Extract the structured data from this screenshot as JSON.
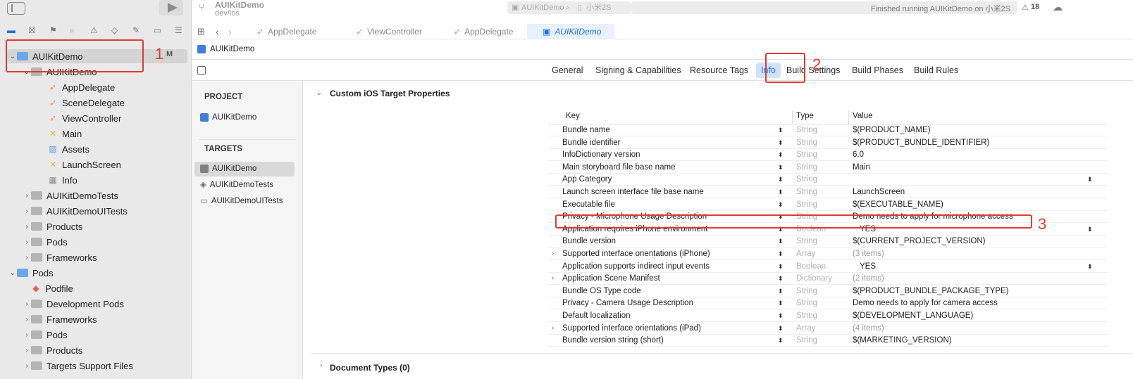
{
  "toolbar": {
    "project_name": "AUIKitDemo",
    "branch": "dev/ios",
    "scheme_target": "AUIKitDemo",
    "scheme_device": "小米2S",
    "status": "Finished running AUIKitDemo on 小米2S",
    "warnings_count": "18"
  },
  "navigator": {
    "project_label": "AUIKitDemo",
    "project_badge": "M",
    "items": [
      {
        "label": "AUIKitDemo",
        "kind": "folder"
      },
      {
        "label": "AppDelegate",
        "kind": "swift"
      },
      {
        "label": "SceneDelegate",
        "kind": "swift"
      },
      {
        "label": "ViewController",
        "kind": "swift"
      },
      {
        "label": "Main",
        "kind": "storyboard"
      },
      {
        "label": "Assets",
        "kind": "assets"
      },
      {
        "label": "LaunchScreen",
        "kind": "storyboard"
      },
      {
        "label": "Info",
        "kind": "plist"
      },
      {
        "label": "AUIKitDemoTests",
        "kind": "folder"
      },
      {
        "label": "AUIKitDemoUITests",
        "kind": "folder"
      },
      {
        "label": "Products",
        "kind": "folder"
      },
      {
        "label": "Pods",
        "kind": "folder"
      },
      {
        "label": "Frameworks",
        "kind": "folder"
      },
      {
        "label": "Pods",
        "kind": "project"
      },
      {
        "label": "Podfile",
        "kind": "podfile"
      },
      {
        "label": "Development Pods",
        "kind": "folder"
      },
      {
        "label": "Frameworks",
        "kind": "folder"
      },
      {
        "label": "Pods",
        "kind": "folder"
      },
      {
        "label": "Products",
        "kind": "folder"
      },
      {
        "label": "Targets Support Files",
        "kind": "folder"
      }
    ]
  },
  "editor_tabs": [
    "AppDelegate",
    "ViewController",
    "AppDelegate",
    "AUIKitDemo"
  ],
  "jump_bar": "AUIKitDemo",
  "info_tabs": [
    "General",
    "Signing & Capabilities",
    "Resource Tags",
    "Info",
    "Build Settings",
    "Build Phases",
    "Build Rules"
  ],
  "targets_panel": {
    "project_header": "PROJECT",
    "project_item": "AUIKitDemo",
    "targets_header": "TARGETS",
    "targets": [
      "AUIKitDemo",
      "AUIKitDemoTests",
      "AUIKitDemoUITests"
    ]
  },
  "properties": {
    "section_title": "Custom iOS Target Properties",
    "col_key": "Key",
    "col_type": "Type",
    "col_value": "Value",
    "rows": [
      {
        "key": "Bundle name",
        "type": "String",
        "value": "$(PRODUCT_NAME)"
      },
      {
        "key": "Bundle identifier",
        "type": "String",
        "value": "$(PRODUCT_BUNDLE_IDENTIFIER)"
      },
      {
        "key": "InfoDictionary version",
        "type": "String",
        "value": "6.0"
      },
      {
        "key": "Main storyboard file base name",
        "type": "String",
        "value": "Main"
      },
      {
        "key": "App Category",
        "type": "String",
        "value": ""
      },
      {
        "key": "Launch screen interface file base name",
        "type": "String",
        "value": "LaunchScreen"
      },
      {
        "key": "Executable file",
        "type": "String",
        "value": "$(EXECUTABLE_NAME)"
      },
      {
        "key": "Privacy - Microphone Usage Description",
        "type": "String",
        "value": "Demo needs to apply for microphone access"
      },
      {
        "key": "Application requires iPhone environment",
        "type": "Boolean",
        "value": "YES"
      },
      {
        "key": "Bundle version",
        "type": "String",
        "value": "$(CURRENT_PROJECT_VERSION)"
      },
      {
        "key": "Supported interface orientations (iPhone)",
        "type": "Array",
        "value": "(3 items)"
      },
      {
        "key": "Application supports indirect input events",
        "type": "Boolean",
        "value": "YES"
      },
      {
        "key": "Application Scene Manifest",
        "type": "Dictionary",
        "value": "(2 items)"
      },
      {
        "key": "Bundle OS Type code",
        "type": "String",
        "value": "$(PRODUCT_BUNDLE_PACKAGE_TYPE)"
      },
      {
        "key": "Privacy - Camera Usage Description",
        "type": "String",
        "value": "Demo needs to apply for camera access"
      },
      {
        "key": "Default localization",
        "type": "String",
        "value": "$(DEVELOPMENT_LANGUAGE)"
      },
      {
        "key": "Supported interface orientations (iPad)",
        "type": "Array",
        "value": "(4 items)"
      },
      {
        "key": "Bundle version string (short)",
        "type": "String",
        "value": "$(MARKETING_VERSION)"
      }
    ],
    "document_types": "Document Types (0)"
  },
  "annotations": {
    "n1": "1",
    "n2": "2",
    "n3": "3"
  },
  "colors": {
    "accent": "#1a73e8",
    "highlight_red": "#e03a30",
    "selected_row": "#d4d4d4"
  }
}
